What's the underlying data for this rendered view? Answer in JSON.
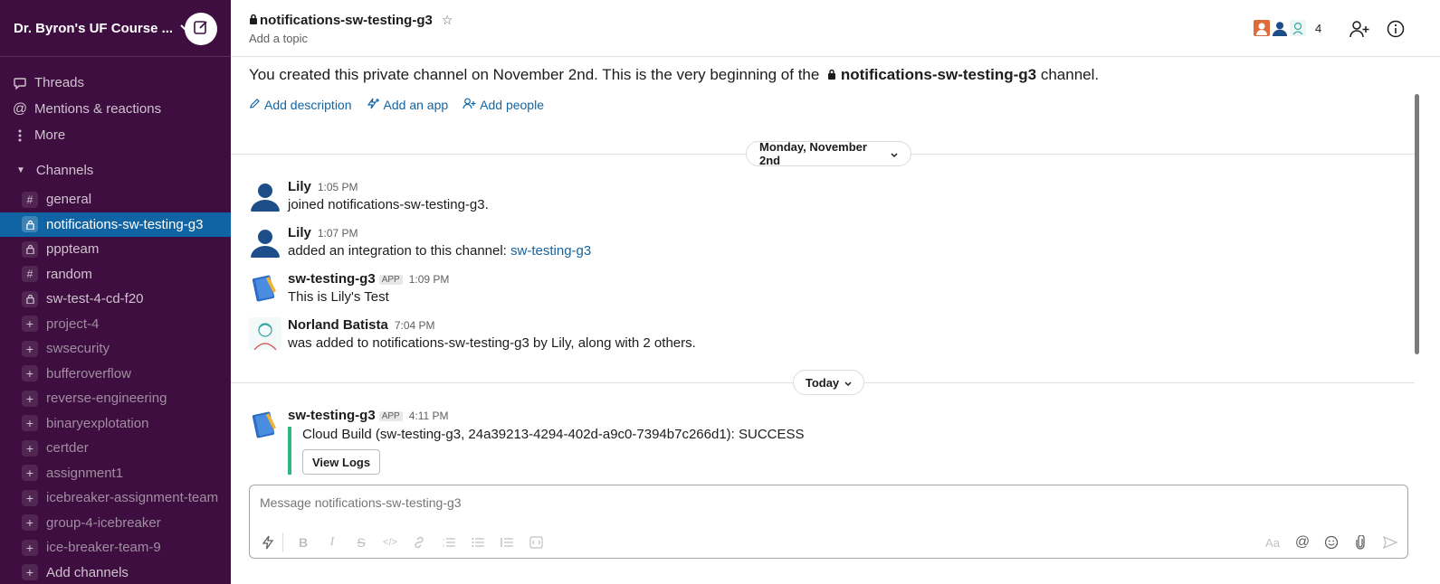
{
  "workspace": {
    "name": "Dr. Byron's UF Course ...",
    "compose_icon": "compose-icon"
  },
  "sidebar": {
    "nav": [
      {
        "label": "Threads",
        "icon": "threads-icon"
      },
      {
        "label": "Mentions & reactions",
        "icon": "at-icon"
      },
      {
        "label": "More",
        "icon": "more-vertical-icon"
      }
    ],
    "channels_header": "Channels",
    "channels": [
      {
        "name": "general",
        "type": "public",
        "active": false,
        "muted": false
      },
      {
        "name": "notifications-sw-testing-g3",
        "type": "private",
        "active": true,
        "muted": false
      },
      {
        "name": "pppteam",
        "type": "private",
        "active": false,
        "muted": false
      },
      {
        "name": "random",
        "type": "public",
        "active": false,
        "muted": false
      },
      {
        "name": "sw-test-4-cd-f20",
        "type": "private",
        "active": false,
        "muted": false
      },
      {
        "name": "project-4",
        "type": "join",
        "active": false,
        "muted": true
      },
      {
        "name": "swsecurity",
        "type": "join",
        "active": false,
        "muted": true
      },
      {
        "name": "bufferoverflow",
        "type": "join",
        "active": false,
        "muted": true
      },
      {
        "name": "reverse-engineering",
        "type": "join",
        "active": false,
        "muted": true
      },
      {
        "name": "binaryexplotation",
        "type": "join",
        "active": false,
        "muted": true
      },
      {
        "name": "certder",
        "type": "join",
        "active": false,
        "muted": true
      },
      {
        "name": "assignment1",
        "type": "join",
        "active": false,
        "muted": true
      },
      {
        "name": "icebreaker-assignment-team",
        "type": "join",
        "active": false,
        "muted": true
      },
      {
        "name": "group-4-icebreaker",
        "type": "join",
        "active": false,
        "muted": true
      },
      {
        "name": "ice-breaker-team-9",
        "type": "join",
        "active": false,
        "muted": true
      },
      {
        "name": "Add channels",
        "type": "add",
        "active": false,
        "muted": false
      }
    ]
  },
  "header": {
    "channel_name": "notifications-sw-testing-g3",
    "topic_placeholder": "Add a topic",
    "member_count": "4"
  },
  "intro": {
    "text_before": "You created this private channel on November 2nd. This is the very beginning of the",
    "channel_name": "notifications-sw-testing-g3",
    "text_after": "channel.",
    "actions": [
      "Add description",
      "Add an app",
      "Add people"
    ]
  },
  "dividers": {
    "first": "Monday, November 2nd",
    "second": "Today"
  },
  "messages": [
    {
      "author": "Lily",
      "app": false,
      "time": "1:05 PM",
      "text": "joined notifications-sw-testing-g3."
    },
    {
      "author": "Lily",
      "app": false,
      "time": "1:07 PM",
      "text": "added an integration to this channel:",
      "link": "sw-testing-g3"
    },
    {
      "author": "sw-testing-g3",
      "app": true,
      "app_label": "APP",
      "time": "1:09 PM",
      "text": "This is Lily's Test"
    },
    {
      "author": "Norland Batista",
      "app": false,
      "time": "7:04 PM",
      "text": "was added to notifications-sw-testing-g3 by Lily, along with 2 others."
    },
    {
      "author": "sw-testing-g3",
      "app": true,
      "app_label": "APP",
      "time": "4:11 PM",
      "attachment": "Cloud Build (sw-testing-g3, 24a39213-4294-402d-a9c0-7394b7c266d1): SUCCESS",
      "button": "View Logs"
    }
  ],
  "composer": {
    "placeholder": "Message notifications-sw-testing-g3"
  },
  "colors": {
    "sidebar_bg": "#3f0e40",
    "active_channel": "#1164a3",
    "link": "#1264a3",
    "success_bar": "#2eb67d"
  }
}
